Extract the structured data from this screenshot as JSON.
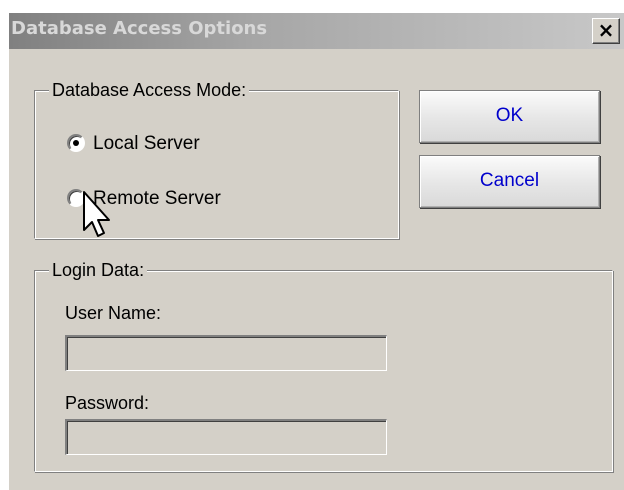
{
  "window": {
    "title": "Database Access Options",
    "close_glyph": "×"
  },
  "access_mode": {
    "label": "Database Access Mode:",
    "options": [
      {
        "label": "Local Server",
        "selected": true
      },
      {
        "label": "Remote Server",
        "selected": false
      }
    ]
  },
  "buttons": {
    "ok": "OK",
    "cancel": "Cancel"
  },
  "login": {
    "label": "Login Data:",
    "user_name_label": "User Name:",
    "user_name_value": "",
    "password_label": "Password:",
    "password_value": ""
  },
  "colors": {
    "dialog_face": "#d4d0c8",
    "button_text": "#0000cc",
    "inactive_title": "#808080"
  }
}
